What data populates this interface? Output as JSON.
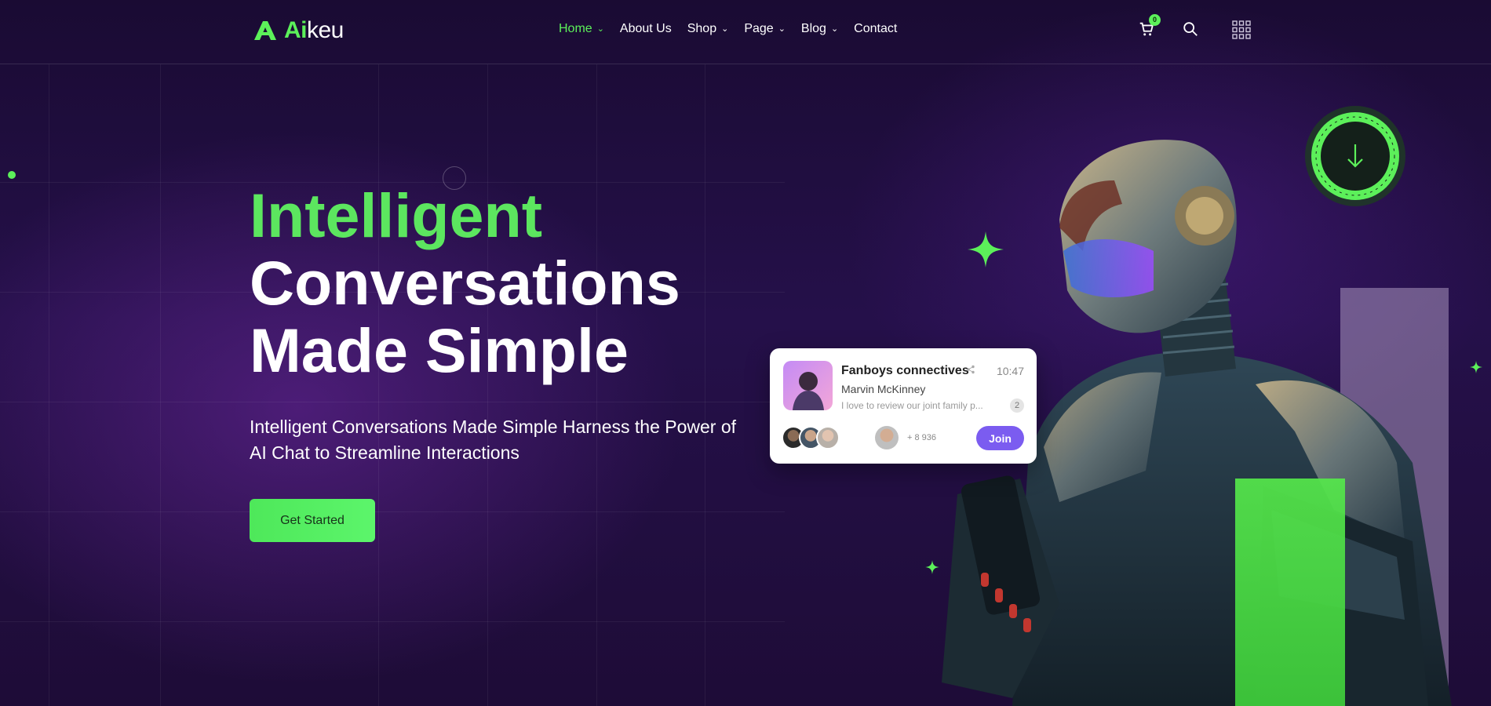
{
  "brand": {
    "name_accent": "Ai",
    "name_rest": "keu"
  },
  "nav": {
    "items": [
      {
        "label": "Home",
        "active": true,
        "dropdown": true
      },
      {
        "label": "About Us",
        "active": false,
        "dropdown": false
      },
      {
        "label": "Shop",
        "active": false,
        "dropdown": true
      },
      {
        "label": "Page",
        "active": false,
        "dropdown": true
      },
      {
        "label": "Blog",
        "active": false,
        "dropdown": true
      },
      {
        "label": "Contact",
        "active": false,
        "dropdown": false
      }
    ],
    "chevron": "⌄"
  },
  "header_actions": {
    "cart_count": "0",
    "icons": [
      "cart-icon",
      "search-icon",
      "apps-grid-icon"
    ]
  },
  "hero": {
    "title_line1": "Intelligent",
    "title_line2": "Conversations",
    "title_line3": "Made Simple",
    "subtitle": "Intelligent Conversations Made Simple Harness the Power of AI Chat to Streamline Interactions",
    "cta_label": "Get Started"
  },
  "chat_card": {
    "title": "Fanboys connectives",
    "time": "10:47",
    "name": "Marvin McKinney",
    "message": "I love to review our joint family p...",
    "unread": "2",
    "members": "+ 8 936",
    "join_label": "Join"
  },
  "colors": {
    "accent": "#5cf05a",
    "purple": "#7b5cf0",
    "bg": "#1c0d34"
  }
}
